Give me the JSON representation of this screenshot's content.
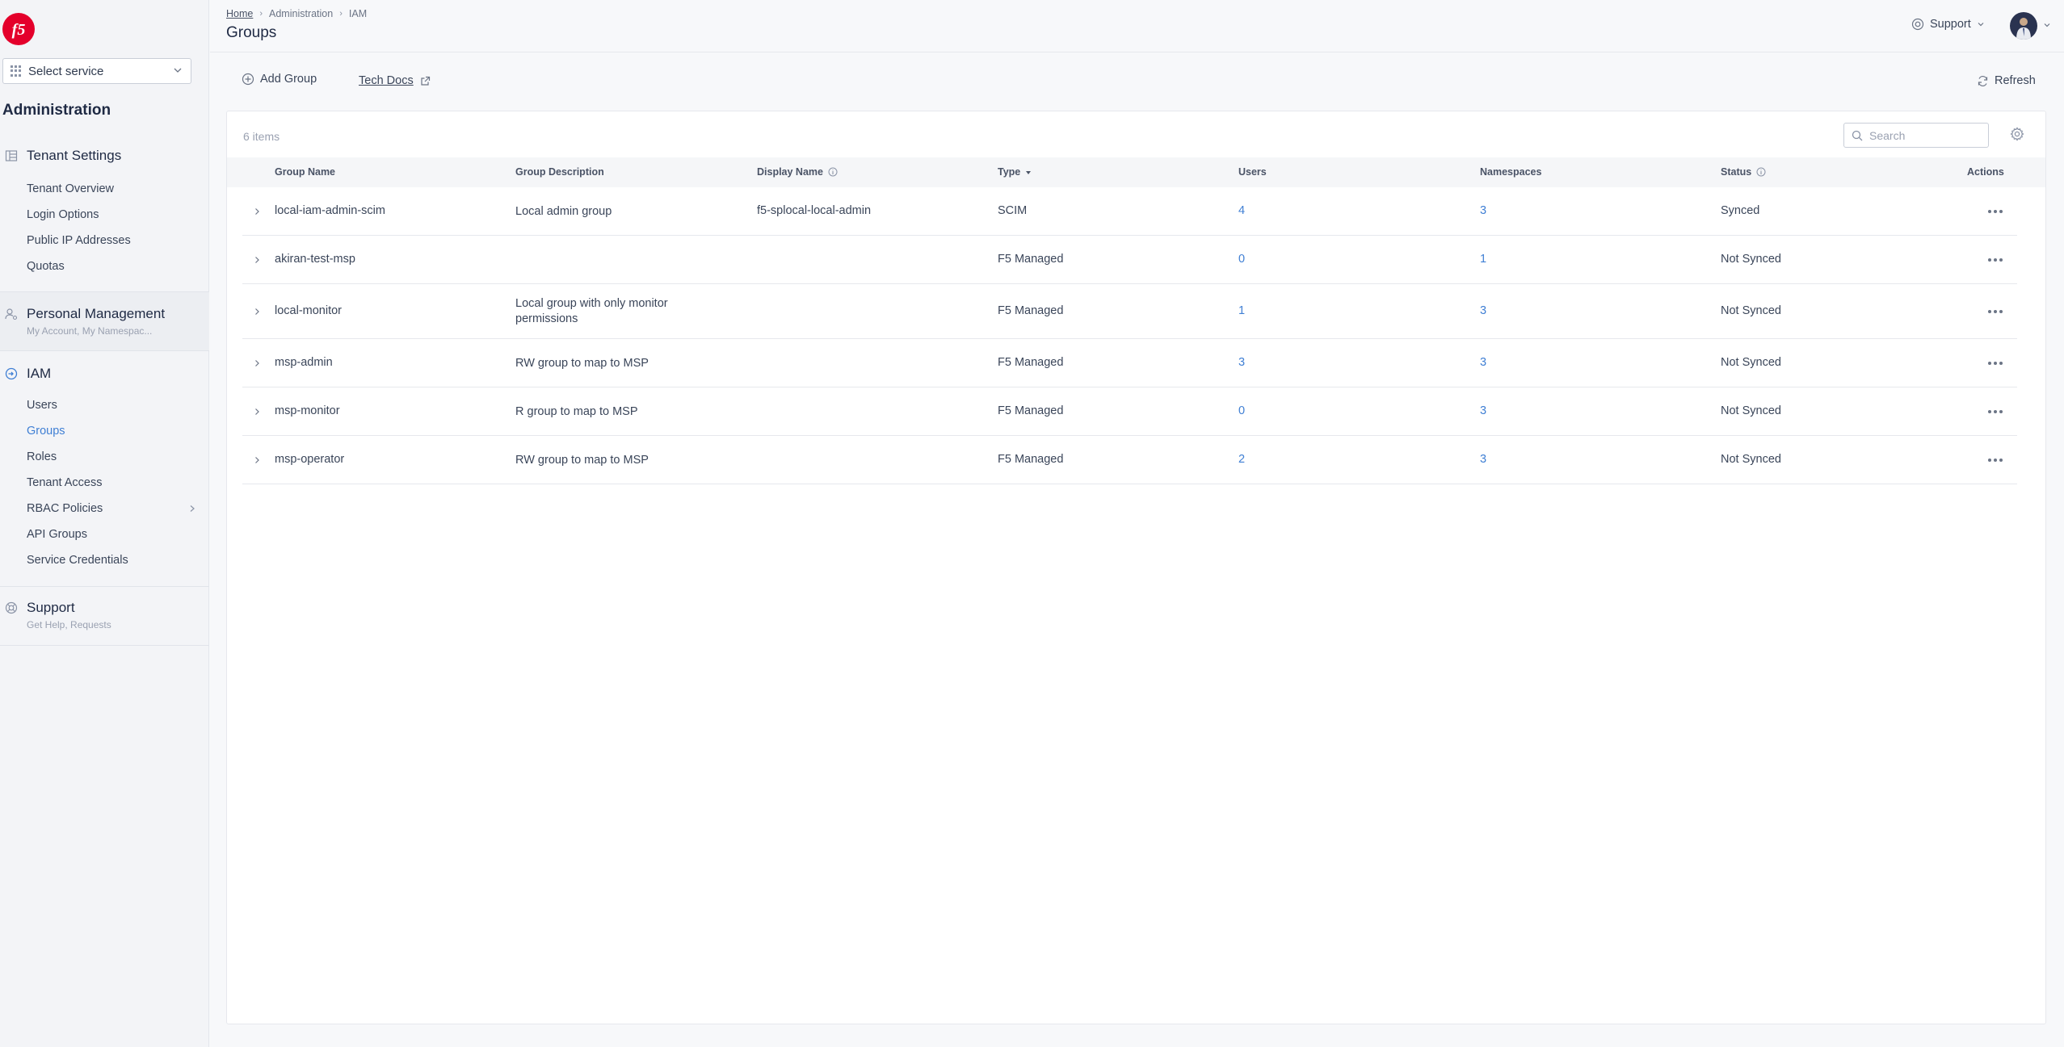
{
  "sidebar": {
    "logo_text": "f5",
    "select_service": "Select service",
    "title": "Administration",
    "sections": [
      {
        "icon": "building-icon",
        "label": "Tenant Settings",
        "items": [
          "Tenant Overview",
          "Login Options",
          "Public IP Addresses",
          "Quotas"
        ]
      },
      {
        "icon": "person-gear-icon",
        "label": "Personal Management",
        "sub": "My Account, My Namespac..."
      },
      {
        "icon": "iam-icon",
        "label": "IAM",
        "items": [
          "Users",
          "Groups",
          "Roles",
          "Tenant Access",
          "RBAC Policies",
          "API Groups",
          "Service Credentials"
        ],
        "active": "Groups"
      },
      {
        "icon": "support-icon",
        "label": "Support",
        "sub": "Get Help, Requests"
      }
    ]
  },
  "header": {
    "breadcrumb": [
      "Home",
      "Administration",
      "IAM"
    ],
    "title": "Groups",
    "support_label": "Support"
  },
  "toolbar": {
    "add_group": "Add Group",
    "tech_docs": "Tech Docs",
    "refresh": "Refresh"
  },
  "table": {
    "items_count": "6 items",
    "search_placeholder": "Search",
    "columns": [
      "Group Name",
      "Group Description",
      "Display Name",
      "Type",
      "Users",
      "Namespaces",
      "Status",
      "Actions"
    ],
    "rows": [
      {
        "name": "local-iam-admin-scim",
        "description": "Local admin group",
        "display_name": "f5-splocal-local-admin",
        "type": "SCIM",
        "users": "4",
        "namespaces": "3",
        "status": "Synced"
      },
      {
        "name": "akiran-test-msp",
        "description": "",
        "display_name": "",
        "type": "F5 Managed",
        "users": "0",
        "namespaces": "1",
        "status": "Not Synced"
      },
      {
        "name": "local-monitor",
        "description": "Local group with only monitor permissions",
        "display_name": "",
        "type": "F5 Managed",
        "users": "1",
        "namespaces": "3",
        "status": "Not Synced"
      },
      {
        "name": "msp-admin",
        "description": "RW group to map to MSP",
        "display_name": "",
        "type": "F5 Managed",
        "users": "3",
        "namespaces": "3",
        "status": "Not Synced"
      },
      {
        "name": "msp-monitor",
        "description": "R group to map to MSP",
        "display_name": "",
        "type": "F5 Managed",
        "users": "0",
        "namespaces": "3",
        "status": "Not Synced"
      },
      {
        "name": "msp-operator",
        "description": "RW group to map to MSP",
        "display_name": "",
        "type": "F5 Managed",
        "users": "2",
        "namespaces": "3",
        "status": "Not Synced"
      }
    ]
  }
}
